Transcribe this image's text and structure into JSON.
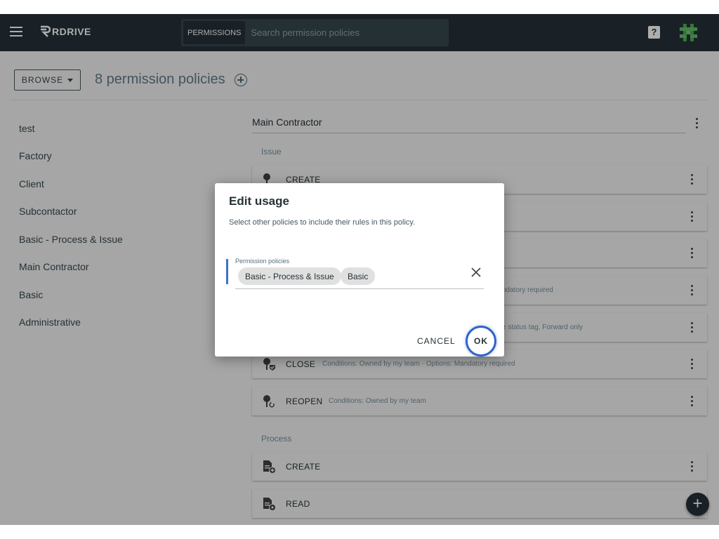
{
  "app": {
    "logo_text": "RDRIVE",
    "search_tag": "PERMISSIONS",
    "search_placeholder": "Search permission policies",
    "help_icon": "?"
  },
  "header": {
    "browse_label": "BROWSE",
    "title": "8 permission policies"
  },
  "sidebar": {
    "items": [
      {
        "label": "test"
      },
      {
        "label": "Factory"
      },
      {
        "label": "Client"
      },
      {
        "label": "Subcontactor"
      },
      {
        "label": "Basic - Process & Issue"
      },
      {
        "label": "Main Contractor"
      },
      {
        "label": "Basic"
      },
      {
        "label": "Administrative"
      }
    ]
  },
  "main": {
    "title": "Main Contractor",
    "sections": {
      "issue": "Issue",
      "process": "Process"
    },
    "issue_rules": [
      {
        "label": "CREATE",
        "conditions": ""
      },
      {
        "label": "",
        "conditions": ""
      },
      {
        "label": "",
        "conditions": ""
      },
      {
        "label": "",
        "conditions": "ndatory required"
      },
      {
        "label": "",
        "conditions": "e status tag, Forward only"
      },
      {
        "label": "CLOSE",
        "conditions": "Conditions: Owned by my team · Options: Mandatory required"
      },
      {
        "label": "REOPEN",
        "conditions": "Conditions: Owned by my team"
      }
    ],
    "process_rules": [
      {
        "label": "CREATE",
        "conditions": ""
      },
      {
        "label": "READ",
        "conditions": ""
      }
    ],
    "fab_label": "+"
  },
  "dialog": {
    "title": "Edit usage",
    "description": "Select other policies to include their rules in this policy.",
    "field_label": "Permission policies",
    "chips": [
      "Basic - Process & Issue",
      "Basic"
    ],
    "cancel_label": "CANCEL",
    "ok_label": "OK"
  },
  "colors": {
    "topbar": "#263238",
    "accent": "#2f63c9",
    "avatar": "#4caf50"
  }
}
